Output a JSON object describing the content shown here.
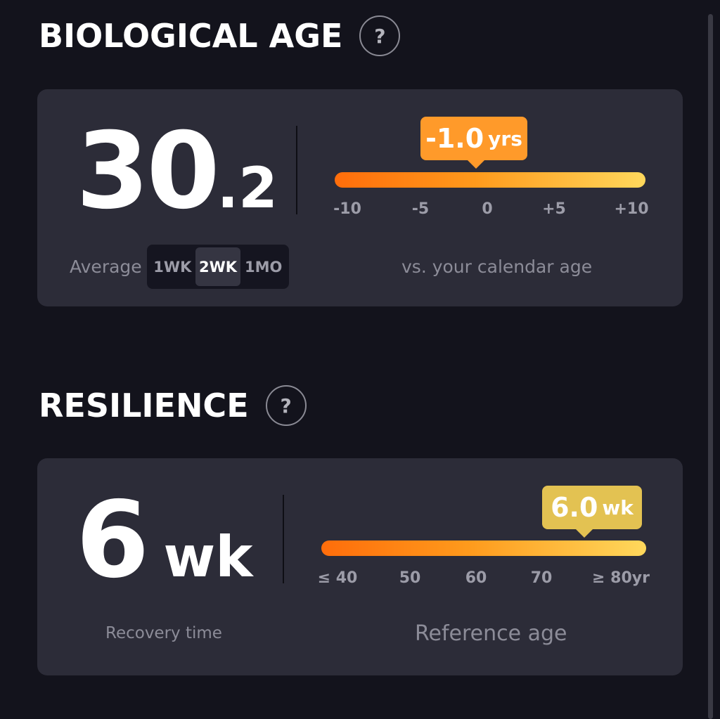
{
  "biological_age": {
    "title": "BIOLOGICAL AGE",
    "help_glyph": "?",
    "value_main": "30",
    "value_decimal": ".2",
    "average_label": "Average",
    "periods": [
      "1WK",
      "2WK",
      "1MO"
    ],
    "selected_period": "2WK",
    "delta_value": "-1.0",
    "delta_unit": "yrs",
    "delta_numeric": -1.0,
    "scale_ticks": [
      "-10",
      "-5",
      "0",
      "+5",
      "+10"
    ],
    "scale_range": [
      -10,
      10
    ],
    "scale_caption": "vs. your calendar age",
    "tooltip_color": "#ff9a2a"
  },
  "resilience": {
    "title": "RESILIENCE",
    "help_glyph": "?",
    "value_main": "6",
    "value_unit": "wk",
    "value_caption": "Recovery time",
    "marker_value": "6.0",
    "marker_unit": "wk",
    "scale_ticks": [
      "≤ 40",
      "50",
      "60",
      "70",
      "≥ 80yr"
    ],
    "scale_caption": "Reference age",
    "marker_position_fraction": 0.84,
    "tooltip_color": "#e3c252"
  }
}
